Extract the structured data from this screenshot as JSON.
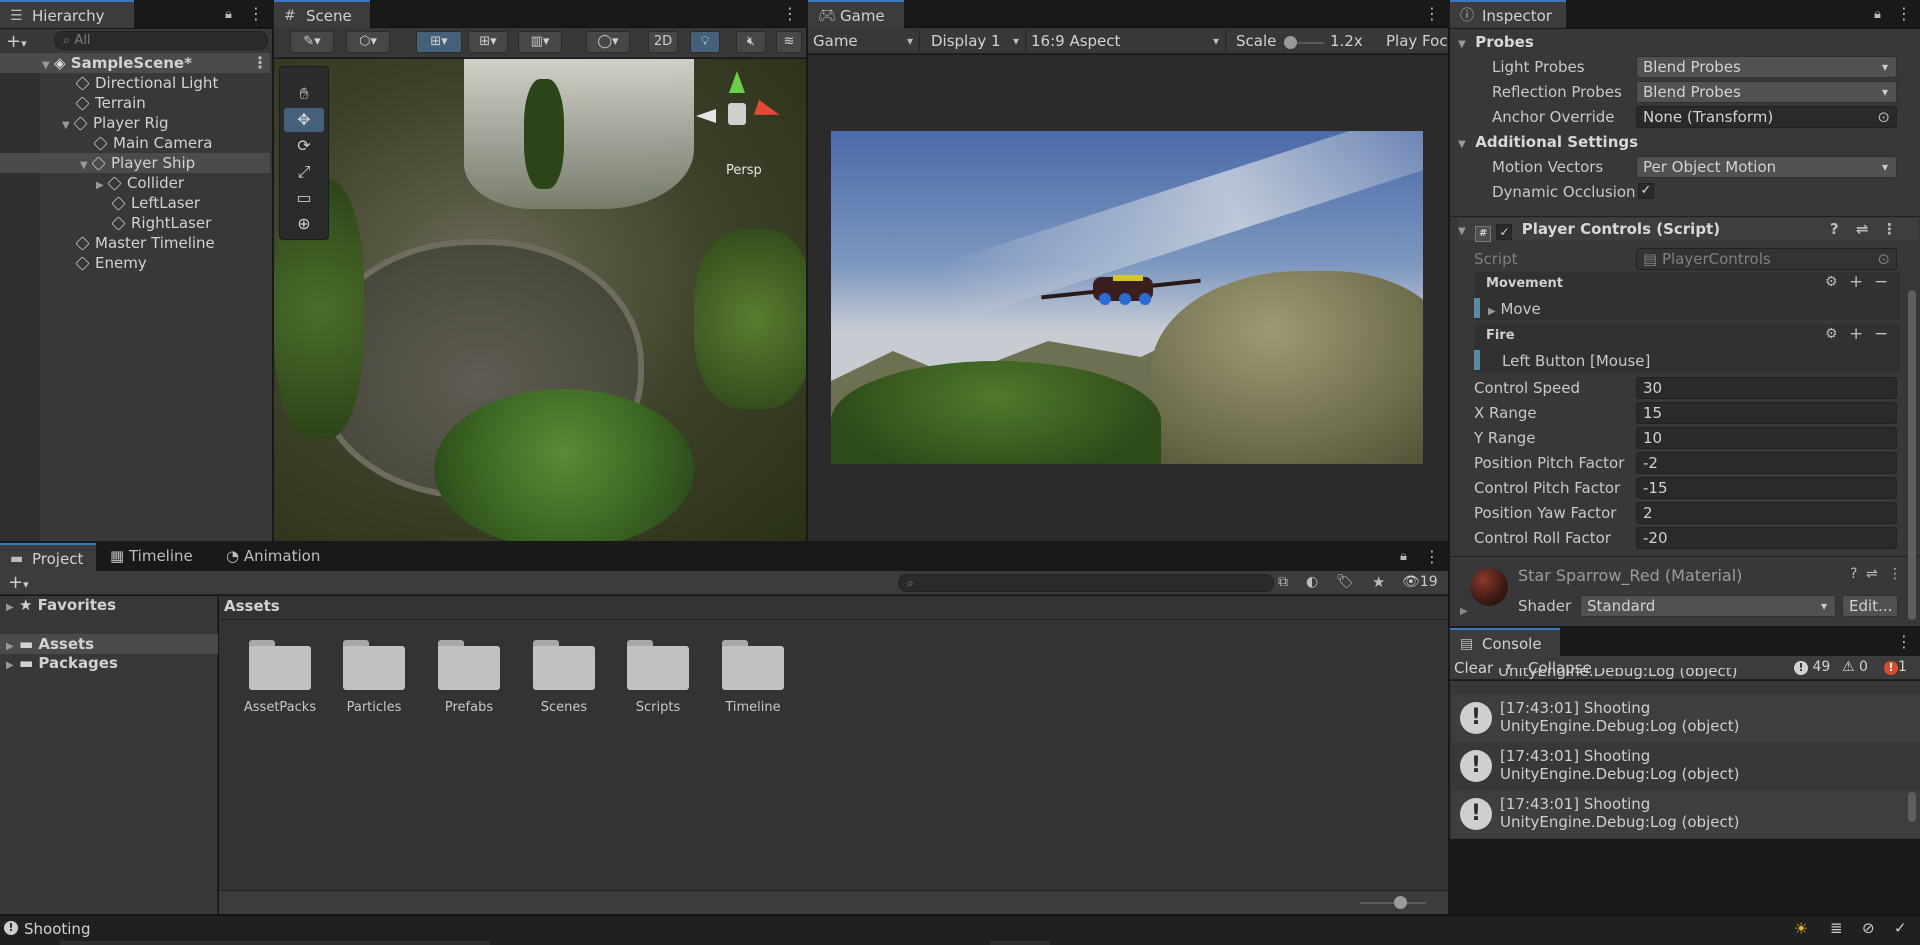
{
  "hierarchy": {
    "tab": "Hierarchy",
    "search_placeholder": "All",
    "scene": "SampleScene*",
    "items": [
      "Directional Light",
      "Terrain",
      "Player Rig",
      "Main Camera",
      "Player Ship",
      "Collider",
      "LeftLaser",
      "RightLaser",
      "Master Timeline",
      "Enemy"
    ]
  },
  "scene": {
    "tab": "Scene",
    "btn_2d": "2D",
    "persp": "Persp"
  },
  "game": {
    "tab": "Game",
    "display_mode": "Game",
    "display": "Display 1",
    "aspect": "16:9 Aspect",
    "scale_label": "Scale",
    "scale_value": "1.2x",
    "play_focused": "Play Foc"
  },
  "inspector": {
    "tab": "Inspector",
    "probes": "Probes",
    "light_probes_label": "Light Probes",
    "light_probes_value": "Blend Probes",
    "reflection_probes_label": "Reflection Probes",
    "reflection_probes_value": "Blend Probes",
    "anchor_override_label": "Anchor Override",
    "anchor_override_value": "None (Transform)",
    "additional_settings": "Additional Settings",
    "motion_vectors_label": "Motion Vectors",
    "motion_vectors_value": "Per Object Motion",
    "dynamic_occlusion_label": "Dynamic Occlusion",
    "component_title": "Player Controls (Script)",
    "script_label": "Script",
    "script_value": "PlayerControls",
    "movement": "Movement",
    "move": "Move",
    "fire": "Fire",
    "fire_binding": "Left Button [Mouse]",
    "fields": [
      {
        "label": "Control Speed",
        "value": "30"
      },
      {
        "label": "X Range",
        "value": "15"
      },
      {
        "label": "Y Range",
        "value": "10"
      },
      {
        "label": "Position Pitch Factor",
        "value": "-2"
      },
      {
        "label": "Control Pitch Factor",
        "value": "-15"
      },
      {
        "label": "Position Yaw Factor",
        "value": "2"
      },
      {
        "label": "Control Roll Factor",
        "value": "-20"
      }
    ],
    "material_title": "Star Sparrow_Red (Material)",
    "shader_label": "Shader",
    "shader_value": "Standard",
    "edit_button": "Edit..."
  },
  "project": {
    "tabs": [
      "Project",
      "Timeline",
      "Animation"
    ],
    "favorites": "Favorites",
    "assets": "Assets",
    "packages": "Packages",
    "breadcrumb": "Assets",
    "hidden_count": "19",
    "folders": [
      "AssetPacks",
      "Particles",
      "Prefabs",
      "Scenes",
      "Scripts",
      "Timeline"
    ]
  },
  "console": {
    "tab": "Console",
    "clear": "Clear",
    "collapse": "Collapse",
    "info_count": "49",
    "warn_count": "0",
    "error_count": "1",
    "partial_line": "UnityEngine.Debug:Log (object)",
    "logs": [
      {
        "line1": "[17:43:01] Shooting",
        "line2": "UnityEngine.Debug:Log (object)"
      },
      {
        "line1": "[17:43:01] Shooting",
        "line2": "UnityEngine.Debug:Log (object)"
      },
      {
        "line1": "[17:43:01] Shooting",
        "line2": "UnityEngine.Debug:Log (object)"
      }
    ]
  },
  "status": {
    "message": "Shooting"
  },
  "colors": {
    "accent": "#3a79bb",
    "panel": "#383838",
    "error": "#d94e2e"
  }
}
